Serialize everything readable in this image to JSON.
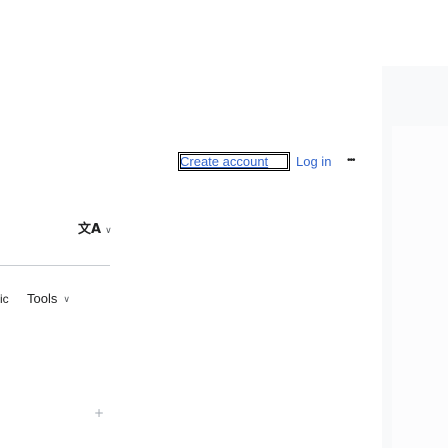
{
  "header": {
    "create_account_label": "Create account",
    "login_label": "Log in",
    "more_label": "•••"
  },
  "language": {
    "icon_glyph": "文A",
    "chevron": "∨"
  },
  "tabs": {
    "partial_label": "ic",
    "tools_label": "Tools",
    "tools_chevron": "∨"
  },
  "sidebar": {
    "add_icon": "+"
  },
  "icons": {
    "language": "language-icon",
    "more": "ellipsis-icon",
    "add": "plus-icon"
  },
  "colors": {
    "link": "#3366cc",
    "text": "#202122",
    "panel": "#f8f9fa"
  }
}
